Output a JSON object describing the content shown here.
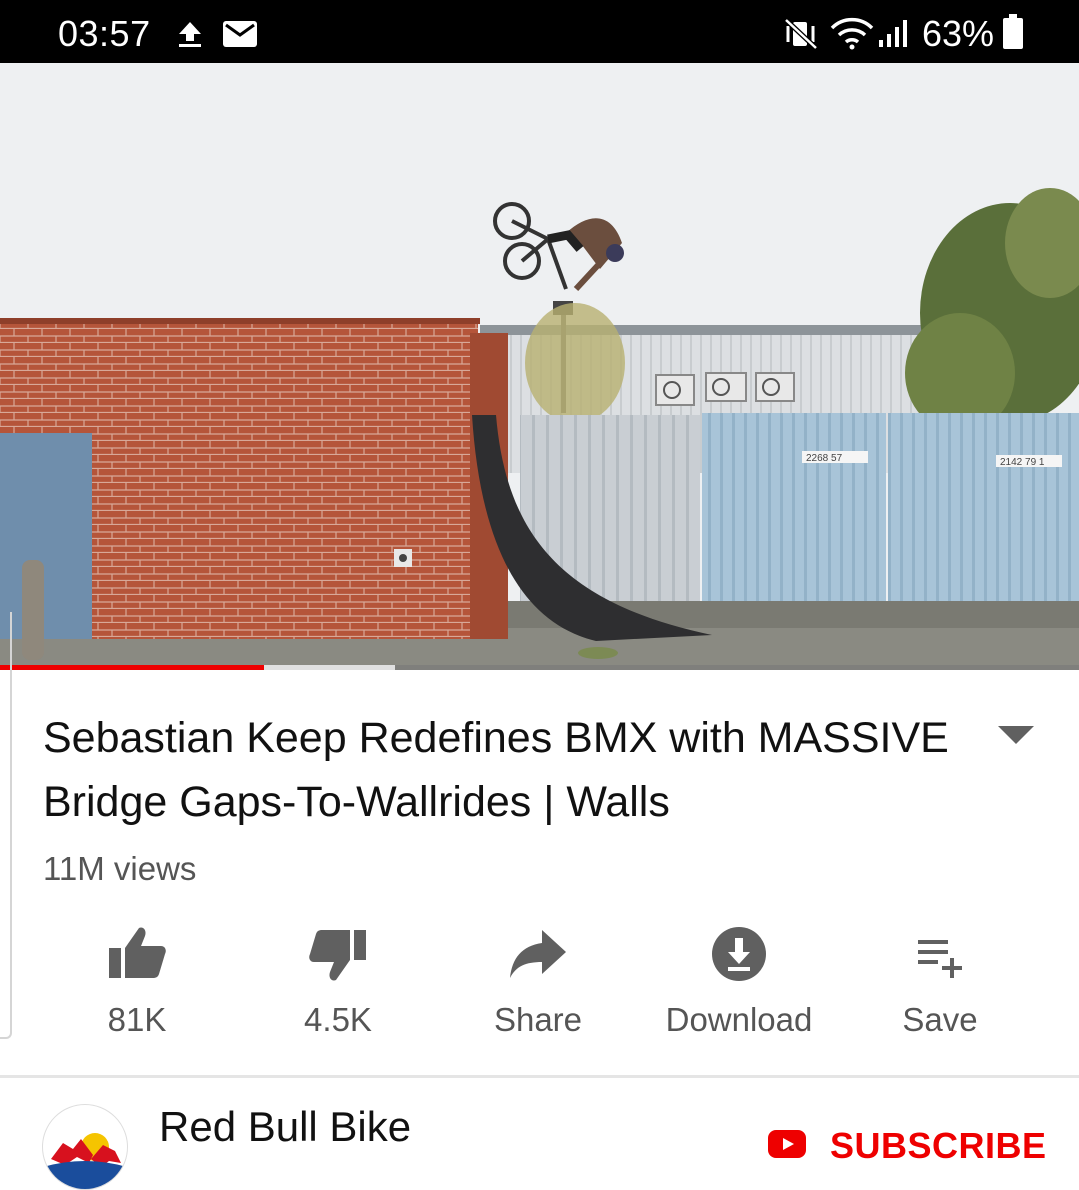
{
  "status_bar": {
    "time": "03:57",
    "battery_percent": "63%",
    "icons": [
      "upload-icon",
      "mail-icon",
      "vibrate-mute-icon",
      "wifi-icon",
      "signal-icon",
      "battery-icon"
    ]
  },
  "video": {
    "container_numbers": [
      "2268 57",
      "2142 79 1"
    ],
    "progress_played": 0.245,
    "progress_buffered": 0.366
  },
  "info": {
    "title": "Sebastian Keep Redefines BMX with MASSIVE Bridge Gaps-To-Wallrides | Walls",
    "views": "11M views"
  },
  "actions": [
    {
      "icon": "thumbs-up-icon",
      "label": "81K"
    },
    {
      "icon": "thumbs-down-icon",
      "label": "4.5K"
    },
    {
      "icon": "share-icon",
      "label": "Share"
    },
    {
      "icon": "download-icon",
      "label": "Download"
    },
    {
      "icon": "save-playlist-icon",
      "label": "Save"
    }
  ],
  "channel": {
    "name": "Red Bull Bike",
    "subscribe_label": "SUBSCRIBE"
  },
  "colors": {
    "accent": "#e00000",
    "status_bar": "#000000"
  }
}
